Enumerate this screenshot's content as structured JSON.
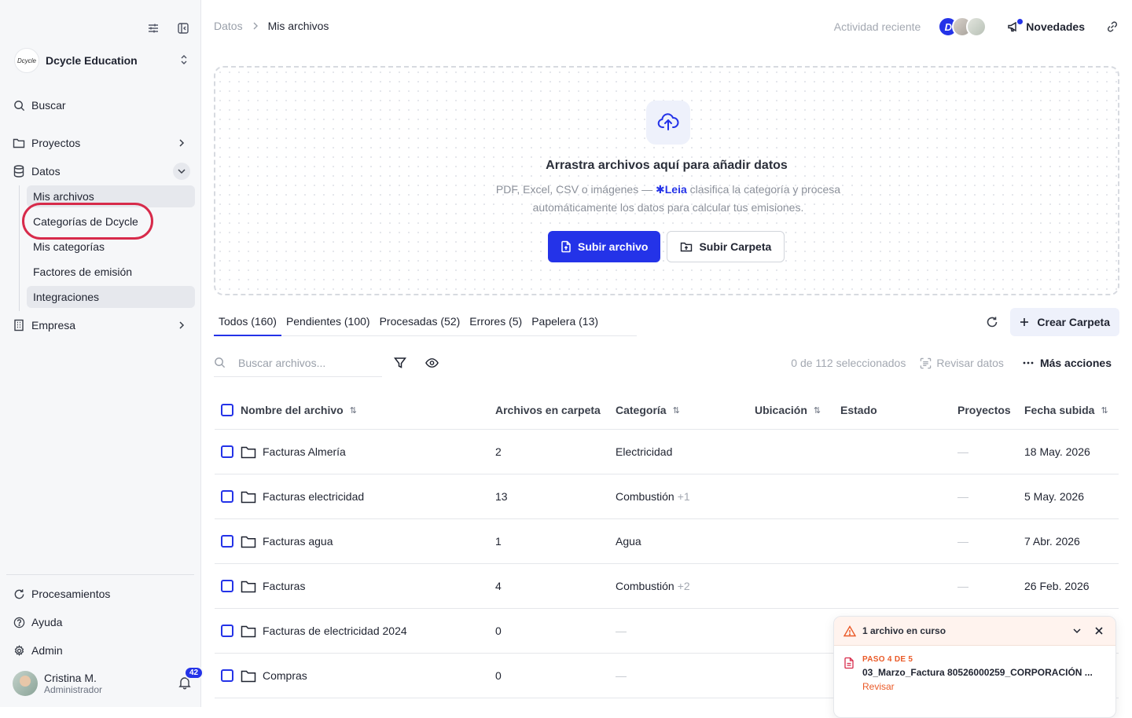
{
  "sidebar": {
    "org_name": "Dcycle Education",
    "org_logo_text": "Dcycle",
    "search_label": "Buscar",
    "nav": {
      "proyectos": "Proyectos",
      "datos": "Datos",
      "empresa": "Empresa"
    },
    "sub_items": [
      "Mis archivos",
      "Categorías de Dcycle",
      "Mis categorías",
      "Factores de emisión",
      "Integraciones"
    ],
    "bottom": {
      "procesamientos": "Procesamientos",
      "ayuda": "Ayuda",
      "admin": "Admin"
    },
    "user": {
      "name": "Cristina M.",
      "role": "Administrador",
      "notifications": "42"
    }
  },
  "header": {
    "breadcrumb": [
      "Datos",
      "Mis archivos"
    ],
    "recent_activity": "Actividad reciente",
    "avatar_initial": "D",
    "news_label": "Novedades"
  },
  "dropzone": {
    "title": "Arrastra archivos aquí para añadir datos",
    "desc_before": "PDF, Excel, CSV o imágenes —",
    "leia": "Leia",
    "desc_after": "clasifica la categoría y procesa automáticamente los datos para calcular tus emisiones.",
    "upload_file": "Subir archivo",
    "upload_folder": "Subir Carpeta"
  },
  "tabs": [
    {
      "label": "Todos (160)"
    },
    {
      "label": "Pendientes (100)"
    },
    {
      "label": "Procesadas (52)"
    },
    {
      "label": "Errores (5)"
    },
    {
      "label": "Papelera (13)"
    }
  ],
  "create_folder": "Crear Carpeta",
  "toolbar": {
    "search_placeholder": "Buscar archivos...",
    "selection": "0 de 112 seleccionados",
    "review": "Revisar datos",
    "more": "Más acciones"
  },
  "table": {
    "headers": {
      "name": "Nombre del archivo",
      "files": "Archivos en carpeta",
      "category": "Categoría",
      "location": "Ubicación",
      "status": "Estado",
      "projects": "Proyectos",
      "date": "Fecha subida"
    },
    "rows": [
      {
        "name": "Facturas Almería",
        "files": "2",
        "category": "Electricidad",
        "extra": "",
        "projects": "—",
        "date": "18 May. 2026"
      },
      {
        "name": "Facturas electricidad",
        "files": "13",
        "category": "Combustión",
        "extra": "+1",
        "projects": "—",
        "date": "5 May. 2026"
      },
      {
        "name": "Facturas agua",
        "files": "1",
        "category": "Agua",
        "extra": "",
        "projects": "—",
        "date": "7 Abr. 2026"
      },
      {
        "name": "Facturas",
        "files": "4",
        "category": "Combustión",
        "extra": "+2",
        "projects": "—",
        "date": "26 Feb. 2026"
      },
      {
        "name": "Facturas de electricidad 2024",
        "files": "0",
        "category": "—",
        "extra": "",
        "projects": "",
        "date": ""
      },
      {
        "name": "Compras",
        "files": "0",
        "category": "—",
        "extra": "",
        "projects": "",
        "date": ""
      }
    ]
  },
  "toast": {
    "title": "1 archivo en curso",
    "step": "PASO 4 DE 5",
    "filename": "03_Marzo_Factura 80526000259_CORPORACIÓN ...",
    "action": "Revisar"
  },
  "colors": {
    "accent": "#2433e8",
    "highlight": "#d72a4a",
    "warning": "#ea5a28"
  }
}
